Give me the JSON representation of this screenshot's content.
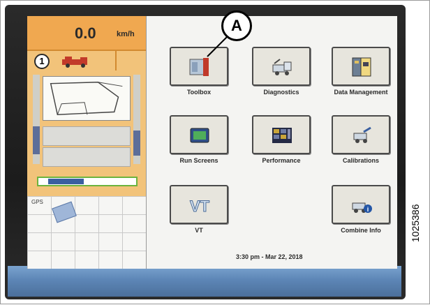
{
  "status": {
    "speed_value": "0.0",
    "speed_unit": "km/h",
    "gear_number": "1"
  },
  "left_panel": {
    "gps_label": "GPS",
    "progress_fraction": 0.45
  },
  "menu": {
    "toolbox": "Toolbox",
    "diagnostics": "Diagnostics",
    "data_management": "Data Management",
    "run_screens": "Run Screens",
    "performance": "Performance",
    "calibrations": "Calibrations",
    "vt": "VT",
    "combine_info": "Combine Info"
  },
  "datetime": "3:30 pm - Mar 22, 2018",
  "callout_label": "A",
  "figure_id": "1025386",
  "colors": {
    "header_orange": "#f0a850",
    "panel_orange": "#f2c37a",
    "button_frame": "#4a4a4a",
    "progress_green": "#6cb33e",
    "bezel_blue": "#5d86b6"
  }
}
